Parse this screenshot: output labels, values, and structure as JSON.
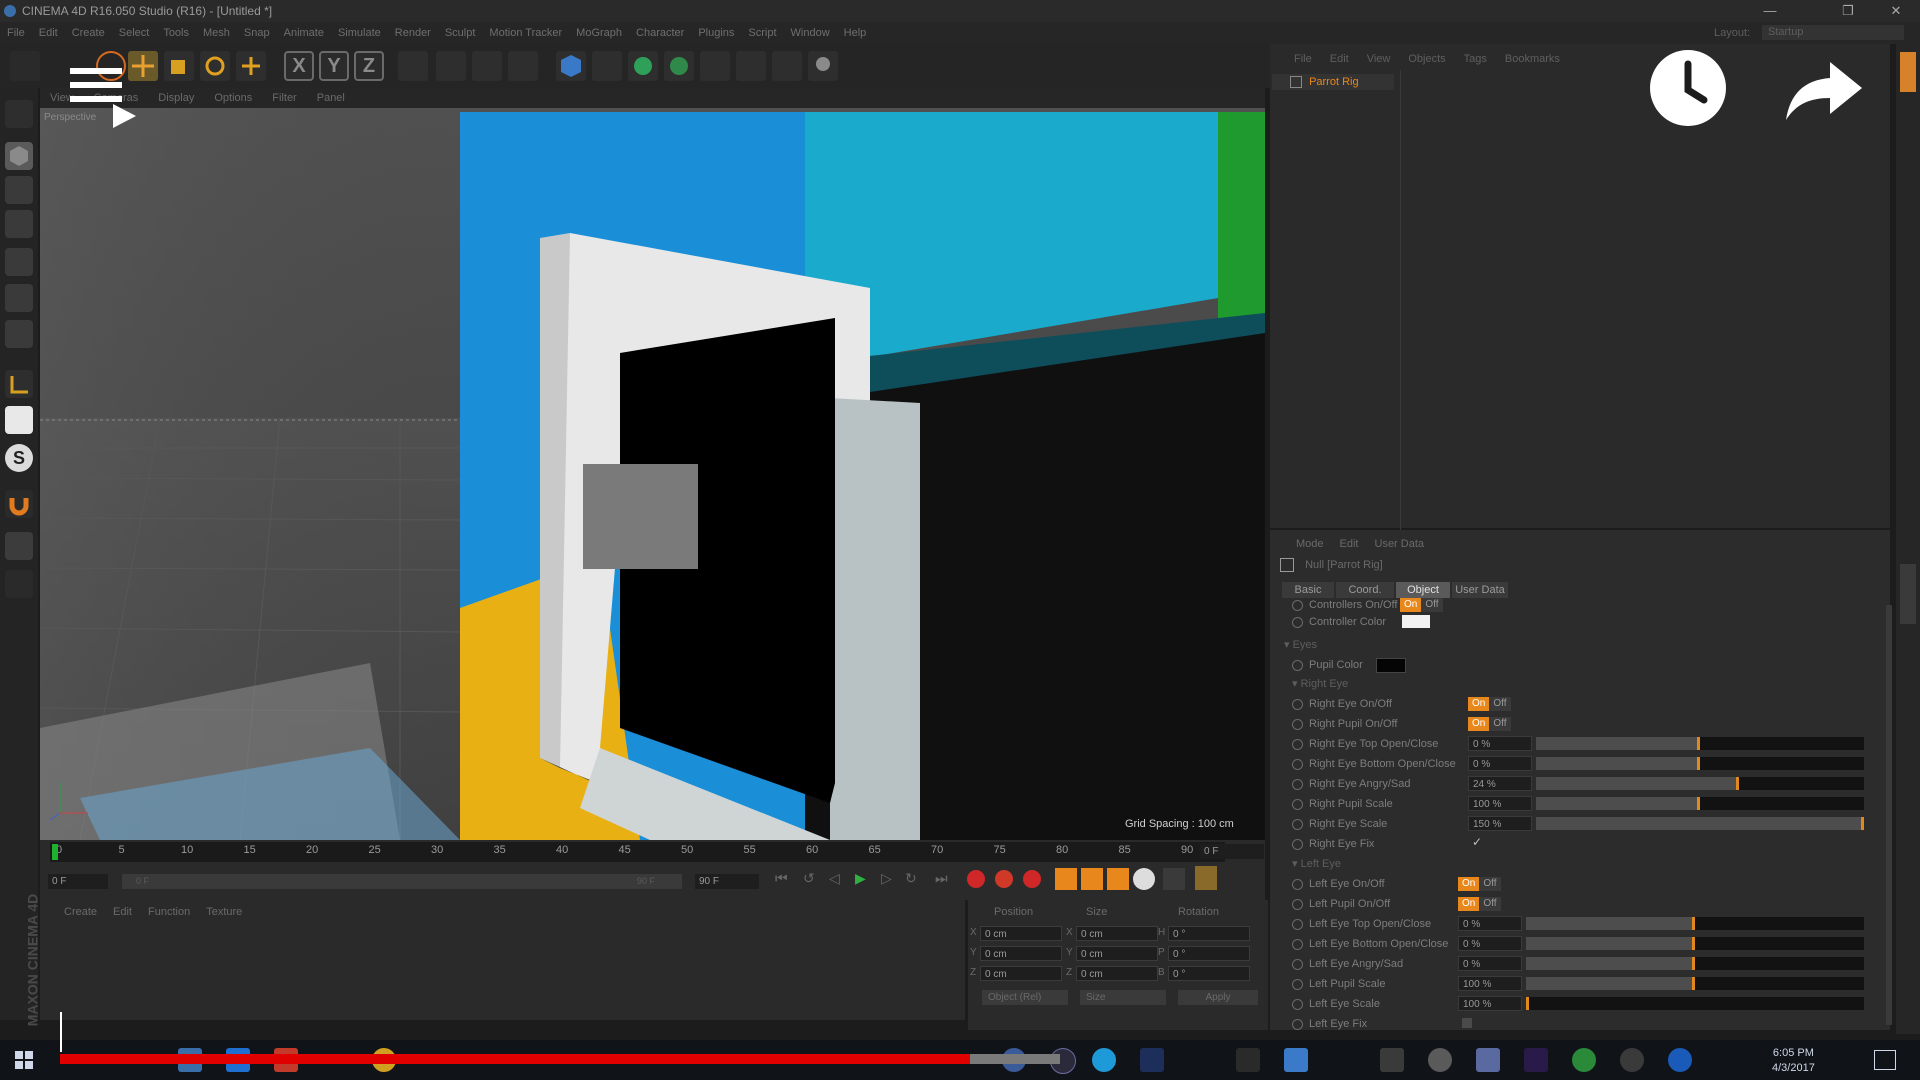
{
  "window": {
    "title": "CINEMA 4D R16.050 Studio (R16) - [Untitled *]",
    "controls": [
      "—",
      "❐",
      "✕"
    ]
  },
  "menu": [
    "File",
    "Edit",
    "Create",
    "Select",
    "Tools",
    "Mesh",
    "Snap",
    "Animate",
    "Simulate",
    "Render",
    "Sculpt",
    "Motion Tracker",
    "MoGraph",
    "Character",
    "Plugins",
    "Script",
    "Window",
    "Help"
  ],
  "layout": {
    "label": "Layout:",
    "value": "Startup"
  },
  "toolbar": {
    "axis_x": "X",
    "axis_y": "Y",
    "axis_z": "Z"
  },
  "viewport": {
    "menu": [
      "View",
      "Cameras",
      "Display",
      "Options",
      "Filter",
      "Panel"
    ],
    "camera_label": "Perspective",
    "grid_spacing": "Grid Spacing : 100 cm"
  },
  "object_manager": {
    "menu": [
      "File",
      "Edit",
      "View",
      "Objects",
      "Tags",
      "Bookmarks"
    ],
    "object_name": "Parrot Rig"
  },
  "attributes": {
    "menu": [
      "Mode",
      "Edit",
      "User Data"
    ],
    "object_title": "Null [Parrot Rig]",
    "tabs": [
      "Basic",
      "Coord.",
      "Object",
      "User Data"
    ],
    "active_tab": "Object",
    "controllers_label": "Controllers On/Off",
    "controller_color_label": "Controller Color",
    "eyes_group": "Eyes",
    "pupil_color_label": "Pupil Color",
    "right_eye_group": "Right Eye",
    "left_eye_group": "Left Eye",
    "on_label": "On",
    "off_label": "Off",
    "right_eye": [
      {
        "label": "Right Eye On/Off",
        "type": "onoff"
      },
      {
        "label": "Right Pupil On/Off",
        "type": "onoff"
      },
      {
        "label": "Right Eye Top Open/Close",
        "type": "slider",
        "value": "0 %",
        "fraction": 0.5
      },
      {
        "label": "Right Eye Bottom Open/Close",
        "type": "slider",
        "value": "0 %",
        "fraction": 0.5
      },
      {
        "label": "Right Eye Angry/Sad",
        "type": "slider",
        "value": "24 %",
        "fraction": 0.62
      },
      {
        "label": "Right Pupil Scale",
        "type": "slider",
        "value": "100 %",
        "fraction": 0.5
      },
      {
        "label": "Right Eye Scale",
        "type": "slider",
        "value": "150 %",
        "fraction": 1.0
      },
      {
        "label": "Right Eye Fix",
        "type": "check",
        "value": "✓"
      }
    ],
    "left_eye": [
      {
        "label": "Left Eye On/Off",
        "type": "onoff"
      },
      {
        "label": "Left Pupil On/Off",
        "type": "onoff"
      },
      {
        "label": "Left Eye Top Open/Close",
        "type": "slider",
        "value": "0 %",
        "fraction": 0.5
      },
      {
        "label": "Left Eye Bottom Open/Close",
        "type": "slider",
        "value": "0 %",
        "fraction": 0.5
      },
      {
        "label": "Left Eye Angry/Sad",
        "type": "slider",
        "value": "0 %",
        "fraction": 0.5
      },
      {
        "label": "Left Pupil Scale",
        "type": "slider",
        "value": "100 %",
        "fraction": 0.5
      },
      {
        "label": "Left Eye Scale",
        "type": "slider",
        "value": "100 %",
        "fraction": 0.0
      },
      {
        "label": "Left Eye Fix",
        "type": "check",
        "value": ""
      }
    ]
  },
  "timeline": {
    "ticks": [
      "0",
      "5",
      "10",
      "15",
      "20",
      "25",
      "30",
      "35",
      "40",
      "45",
      "50",
      "55",
      "60",
      "65",
      "70",
      "75",
      "80",
      "85",
      "90"
    ],
    "current_frame": "0 F",
    "start_frame": "0 F",
    "end_frame": "90 F",
    "range_start": "0 F",
    "range_end": "90 F"
  },
  "materials": {
    "menu": [
      "Create",
      "Edit",
      "Function",
      "Texture"
    ]
  },
  "coordinates": {
    "headers": [
      "Position",
      "Size",
      "Rotation"
    ],
    "rows": [
      {
        "axis": "X",
        "pos": "0 cm",
        "size_axis": "X",
        "size": "0 cm",
        "rot_axis": "H",
        "rot": "0 °"
      },
      {
        "axis": "Y",
        "pos": "0 cm",
        "size_axis": "Y",
        "size": "0 cm",
        "rot_axis": "P",
        "rot": "0 °"
      },
      {
        "axis": "Z",
        "pos": "0 cm",
        "size_axis": "Z",
        "size": "0 cm",
        "rot_axis": "B",
        "rot": "0 °"
      }
    ],
    "mode": "Object (Rel)",
    "size_mode": "Size",
    "apply": "Apply"
  },
  "brand": "MAXON CINEMA 4D",
  "taskbar": {
    "time": "6:05 PM",
    "date": "4/3/2017"
  },
  "video_progress": 0.89,
  "colors": {
    "accent": "#e8881c",
    "progress": "#e00000"
  }
}
